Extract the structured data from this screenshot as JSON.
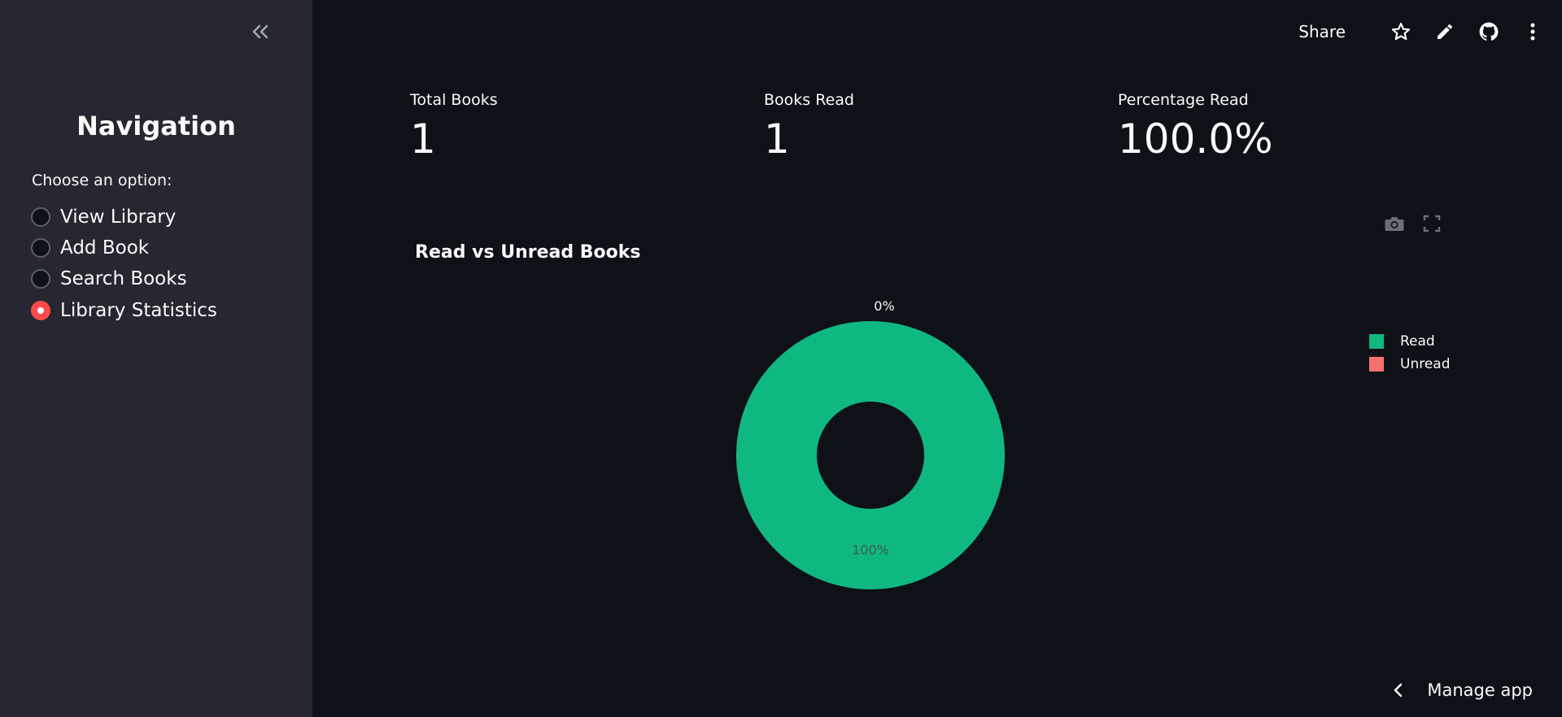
{
  "sidebar": {
    "title": "Navigation",
    "radio_label": "Choose an option:",
    "options": [
      {
        "label": "View Library",
        "selected": false
      },
      {
        "label": "Add Book",
        "selected": false
      },
      {
        "label": "Search Books",
        "selected": false
      },
      {
        "label": "Library Statistics",
        "selected": true
      }
    ],
    "collapse_icon": "double-chevron-left-icon"
  },
  "toolbar": {
    "share_label": "Share",
    "icons": [
      "star-icon",
      "pencil-icon",
      "github-icon",
      "more-vertical-icon"
    ]
  },
  "metrics": [
    {
      "label": "Total Books",
      "value": "1"
    },
    {
      "label": "Books Read",
      "value": "1"
    },
    {
      "label": "Percentage Read",
      "value": "100.0%"
    }
  ],
  "chart_data": {
    "type": "pie",
    "title": "Read vs Unread Books",
    "hole": true,
    "categories": [
      "Read",
      "Unread"
    ],
    "values": [
      1,
      0
    ],
    "labels": [
      "100%",
      "0%"
    ],
    "colors": [
      "#10b881",
      "#f87171"
    ],
    "legend_position": "top-right"
  },
  "chart_tools": [
    "camera-icon",
    "fullscreen-icon"
  ],
  "footer": {
    "manage_label": "Manage app"
  },
  "colors": {
    "background": "#0e1117",
    "sidebar": "#262730",
    "accent": "#ff4b4b",
    "read": "#10b881",
    "unread": "#f87171"
  }
}
